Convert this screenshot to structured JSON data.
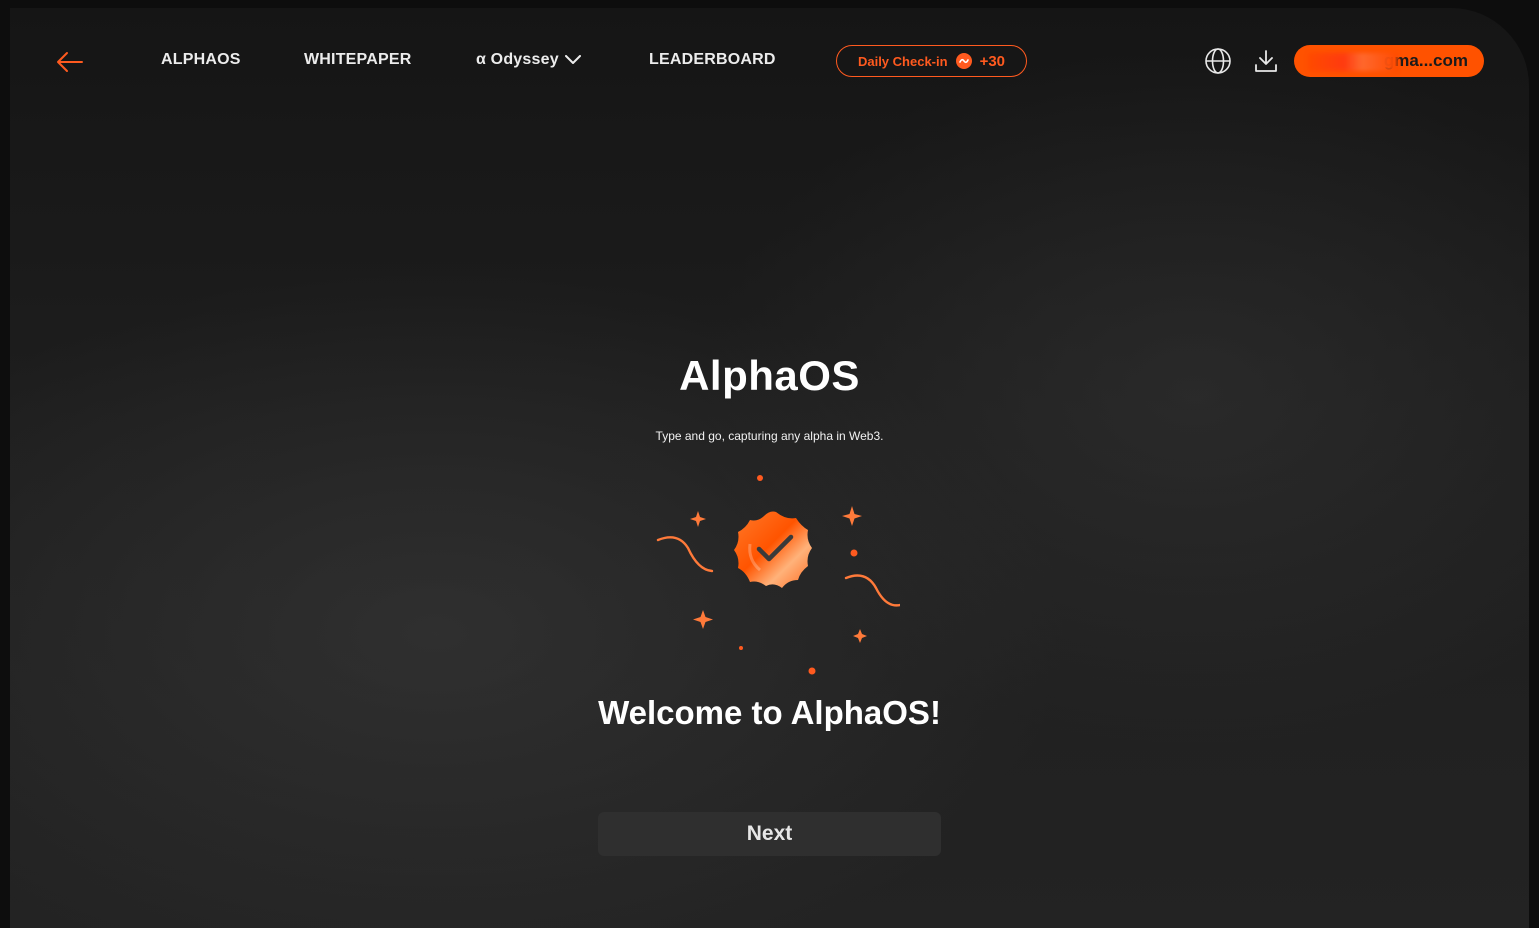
{
  "nav": {
    "alphaos": "ALPHAOS",
    "whitepaper": "WHITEPAPER",
    "odyssey": "α Odyssey",
    "leaderboard": "LEADERBOARD"
  },
  "checkin": {
    "label": "Daily Check-in",
    "points": "+30"
  },
  "account": {
    "email_visible": "gma...com"
  },
  "main": {
    "title": "AlphaOS",
    "subtitle": "Type and go, capturing any alpha in Web3.",
    "welcome": "Welcome to AlphaOS!",
    "next_label": "Next"
  },
  "icons": {
    "back": "arrow-left-icon",
    "globe": "globe-icon",
    "download": "download-icon",
    "chevron": "chevron-down-icon",
    "badge": "verified-badge-icon"
  },
  "colors": {
    "accent": "#ff5a1f",
    "pill": "#ff5200",
    "button_bg": "#2f2f2f"
  }
}
